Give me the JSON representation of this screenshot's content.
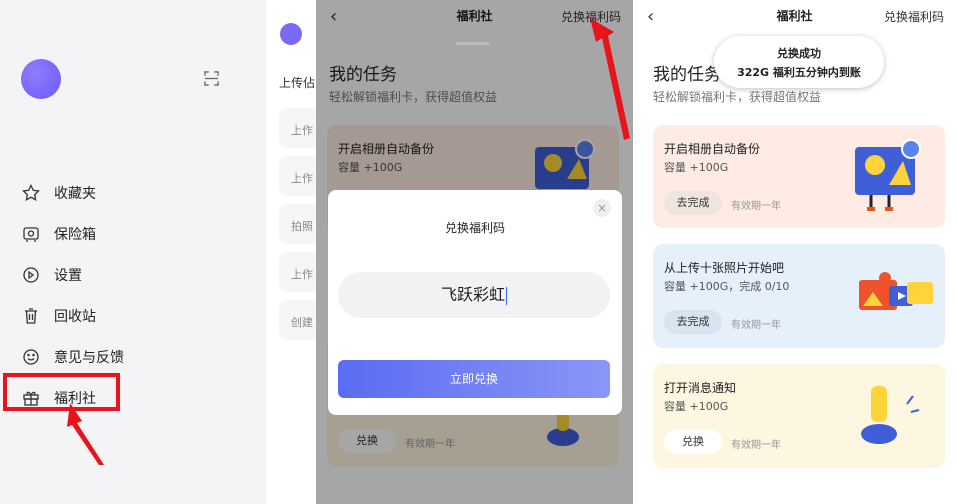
{
  "drawer": {
    "menu": [
      {
        "label": "收藏夹",
        "icon": "star-icon"
      },
      {
        "label": "保险箱",
        "icon": "safe-icon"
      },
      {
        "label": "设置",
        "icon": "settings-icon"
      },
      {
        "label": "回收站",
        "icon": "trash-icon"
      },
      {
        "label": "意见与反馈",
        "icon": "feedback-icon"
      },
      {
        "label": "福利社",
        "icon": "gift-icon"
      }
    ],
    "behind": {
      "heading": "上传佔",
      "cards": [
        "上作",
        "上作",
        "拍照",
        "上作",
        "创建"
      ]
    }
  },
  "page": {
    "title": "福利社",
    "redeem_link": "兑换福利码",
    "tasks_title": "我的任务",
    "tasks_subtitle": "轻松解锁福利卡，获得超值权益"
  },
  "tasks": [
    {
      "title": "开启相册自动备份",
      "reward": "容量 +100G",
      "button": "去完成",
      "validity": "有效期一年"
    },
    {
      "title": "从上传十张照片开始吧",
      "reward": "容量 +100G，完成 0/10",
      "button": "去完成",
      "validity": "有效期一年"
    },
    {
      "title": "打开消息通知",
      "reward": "容量 +100G",
      "button": "兑换",
      "validity": "有效期一年"
    }
  ],
  "dialog": {
    "title": "兑换福利码",
    "input_value": "飞跃彩虹",
    "confirm_button": "立即兑换",
    "close": "×"
  },
  "toast": {
    "line1": "兑换成功",
    "line2": "322G 福利五分钟内到账"
  },
  "colors": {
    "accent": "#6a5af9",
    "highlight_red": "#e8141c",
    "card_orange": "#fdebe4",
    "card_blue": "#e5f0fb",
    "card_yellow": "#fdf6e0"
  }
}
